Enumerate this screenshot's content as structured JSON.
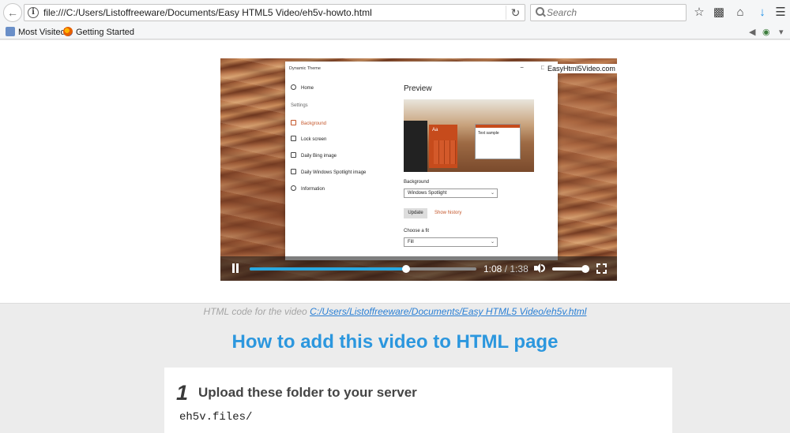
{
  "browser": {
    "url": "file:///C:/Users/Listoffreeware/Documents/Easy HTML5 Video/eh5v-howto.html",
    "search_placeholder": "Search",
    "bookmarks": [
      "Most Visited",
      "Getting Started"
    ]
  },
  "video": {
    "watermark": "EasyHtml5Video.com",
    "current_time": "1:08",
    "separator": "/",
    "duration": "1:38",
    "progress_fraction": 0.69,
    "volume_fraction": 1.0,
    "app": {
      "title": "Dynamic Theme",
      "window_buttons": "− □",
      "nav": {
        "home": "Home",
        "settings_heading": "Settings",
        "background": "Background",
        "lock_screen": "Lock screen",
        "daily_bing": "Daily Bing image",
        "spotlight": "Daily Windows Spotlight image",
        "information": "Information"
      },
      "preview_title": "Preview",
      "preview_aa": "Aa",
      "preview_note": "Text sample",
      "background_label": "Background",
      "background_value": "Windows Spotlight",
      "update_button": "Update",
      "show_history": "Show history",
      "fit_label": "Choose a fit",
      "fit_value": "Fill"
    }
  },
  "page": {
    "code_note_prefix": "HTML code for the video",
    "code_link": "C:/Users/Listoffreeware/Documents/Easy HTML5 Video/eh5v.html",
    "heading": "How to add this video to HTML page",
    "step1": {
      "number": "1",
      "title": "Upload these folder to your server",
      "folder": "eh5v.files/"
    }
  }
}
